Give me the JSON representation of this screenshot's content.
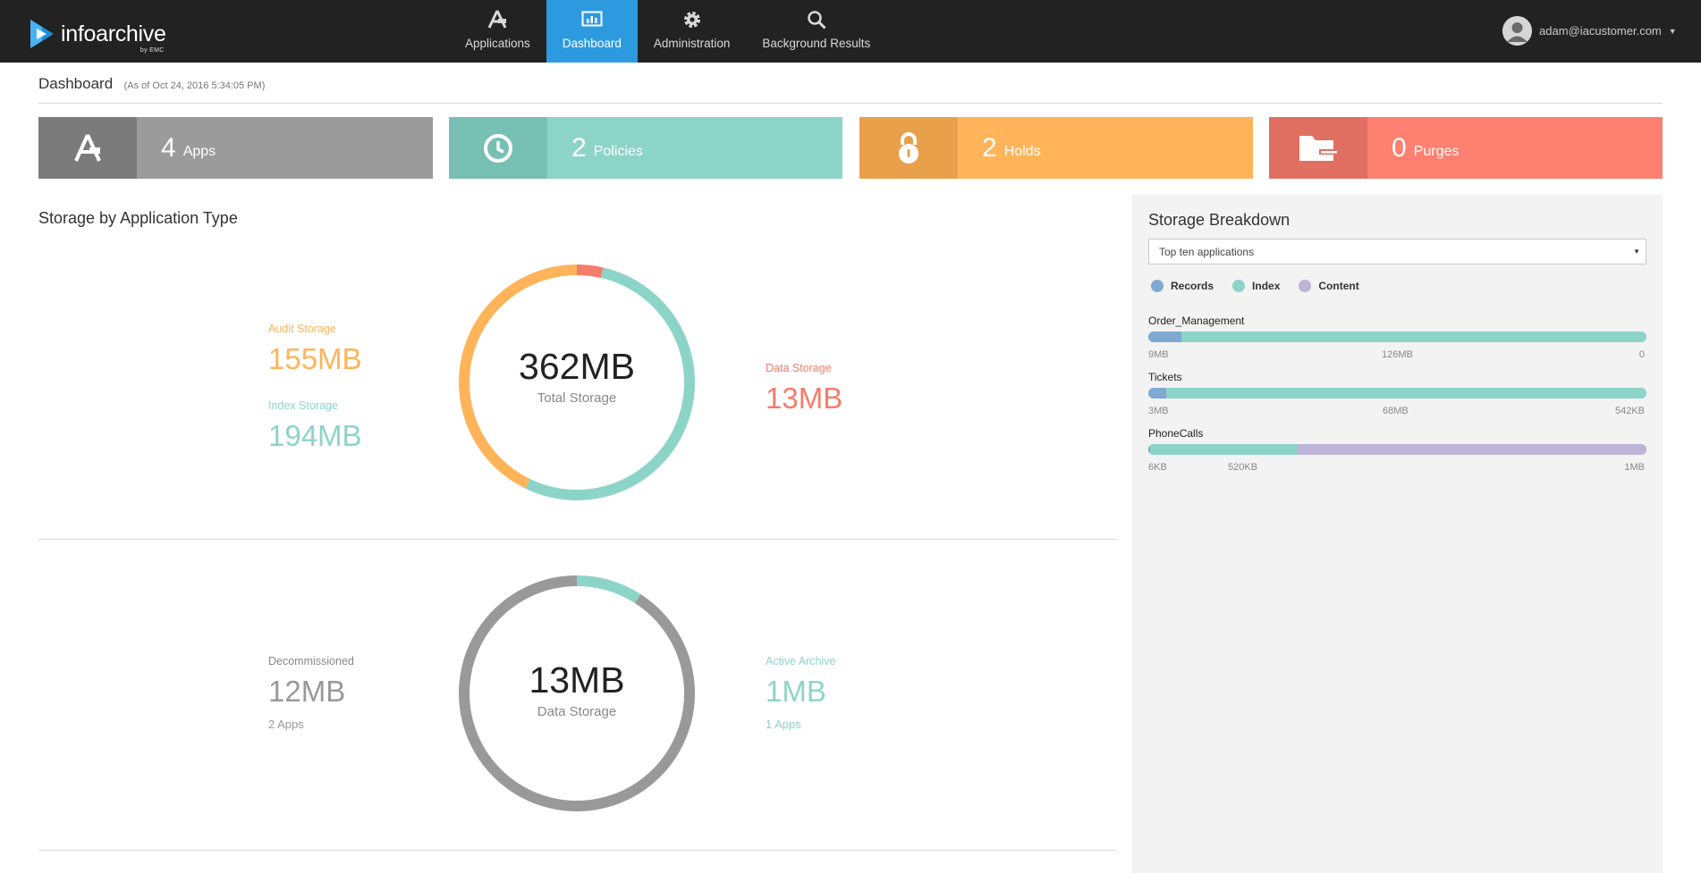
{
  "app": {
    "logo_text": "infoarchive",
    "logo_sub": "by EMC"
  },
  "nav": {
    "items": [
      {
        "label": "Applications",
        "icon": "applications-icon"
      },
      {
        "label": "Dashboard",
        "icon": "dashboard-icon",
        "active": true
      },
      {
        "label": "Administration",
        "icon": "gear-icon"
      },
      {
        "label": "Background Results",
        "icon": "search-icon"
      }
    ],
    "active_color": "#2d9ae0"
  },
  "user": {
    "email": "adam@iacustomer.com"
  },
  "page": {
    "title": "Dashboard",
    "as_of": "(As of Oct 24, 2016 5:34:05 PM)"
  },
  "tiles": [
    {
      "count": "4",
      "label": "Apps",
      "icon": "applications-icon",
      "icon_bg": "#7b7b7b",
      "bg": "#9b9b9b"
    },
    {
      "count": "2",
      "label": "Policies",
      "icon": "clock-icon",
      "icon_bg": "#78bfb4",
      "bg": "#8dd4c8"
    },
    {
      "count": "2",
      "label": "Holds",
      "icon": "lock-icon",
      "icon_bg": "#e8a04a",
      "bg": "#ffb45a"
    },
    {
      "count": "0",
      "label": "Purges",
      "icon": "folder-icon",
      "icon_bg": "#e06f62",
      "bg": "#fd8070"
    }
  ],
  "storage": {
    "title_bold": "Storage",
    "title_rest": " by Application Type",
    "audit": {
      "label": "Audit Storage",
      "value": "155MB",
      "mb": 155,
      "color": "#ffb45a"
    },
    "index": {
      "label": "Index Storage",
      "value": "194MB",
      "mb": 194,
      "color": "#8dd4c8"
    },
    "data": {
      "label": "Data Storage",
      "value": "13MB",
      "mb": 13,
      "color": "#f57d6d"
    },
    "total": {
      "value": "362MB",
      "label": "Total Storage"
    }
  },
  "data_storage": {
    "decommissioned": {
      "label": "Decommissioned",
      "value": "12MB",
      "apps": "2 Apps",
      "mb": 12,
      "color": "#999999"
    },
    "active": {
      "label": "Active Archive",
      "value": "1MB",
      "apps": "1 Apps",
      "mb": 1.2,
      "color": "#8dd4c8"
    },
    "total": {
      "value": "13MB",
      "label": "Data Storage"
    }
  },
  "breakdown": {
    "title": "Storage Breakdown",
    "select_value": "Top ten applications",
    "legend": [
      {
        "label": "Records",
        "color": "#7fa9d2"
      },
      {
        "label": "Index",
        "color": "#8dd4c8"
      },
      {
        "label": "Content",
        "color": "#bdb4d8"
      }
    ],
    "apps": [
      {
        "name": "Order_Management",
        "records": 0.066,
        "index": 0.934,
        "content": 0.0,
        "ticks": [
          "9MB",
          "126MB",
          "0"
        ]
      },
      {
        "name": "Tickets",
        "records": 0.036,
        "index": 0.964,
        "content": 0.0,
        "ticks": [
          "3MB",
          "68MB",
          "542KB"
        ]
      },
      {
        "name": "PhoneCalls",
        "records": 0.004,
        "index": 0.296,
        "content": 0.7,
        "ticks": [
          "6KB",
          "520KB",
          "1MB"
        ]
      }
    ]
  }
}
